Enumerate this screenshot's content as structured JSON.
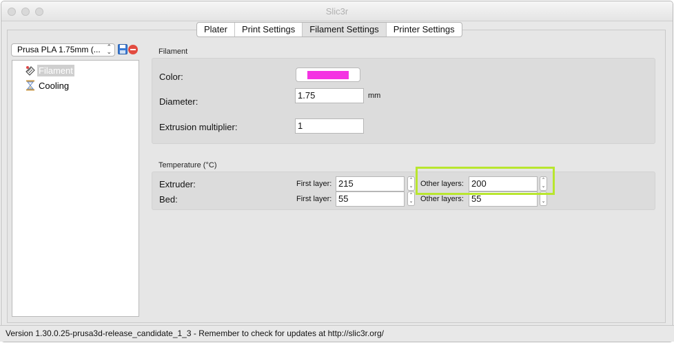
{
  "window": {
    "title": "Slic3r"
  },
  "tabs": [
    {
      "label": "Plater"
    },
    {
      "label": "Print Settings"
    },
    {
      "label": "Filament Settings"
    },
    {
      "label": "Printer Settings"
    }
  ],
  "preset": {
    "value": "Prusa PLA 1.75mm (..."
  },
  "tree": {
    "items": [
      {
        "label": "Filament",
        "icon": "spool-icon"
      },
      {
        "label": "Cooling",
        "icon": "hourglass-icon"
      }
    ]
  },
  "filament": {
    "section_title": "Filament",
    "color_label": "Color:",
    "color_value": "#f433e2",
    "diameter_label": "Diameter:",
    "diameter_value": "1.75",
    "diameter_unit": "mm",
    "extrusion_label": "Extrusion multiplier:",
    "extrusion_value": "1"
  },
  "temperature": {
    "section_title": "Temperature (°C)",
    "extruder_label": "Extruder:",
    "bed_label": "Bed:",
    "first_layer_label": "First layer:",
    "other_layers_label": "Other layers:",
    "extruder_first": "215",
    "extruder_other": "200",
    "bed_first": "55",
    "bed_other": "55"
  },
  "status": {
    "text": "Version 1.30.0.25-prusa3d-release_candidate_1_3 - Remember to check for updates at http://slic3r.org/"
  },
  "colors": {
    "highlight": "#b8e62e",
    "delete": "#e24b40",
    "save": "#3a7bd5"
  }
}
